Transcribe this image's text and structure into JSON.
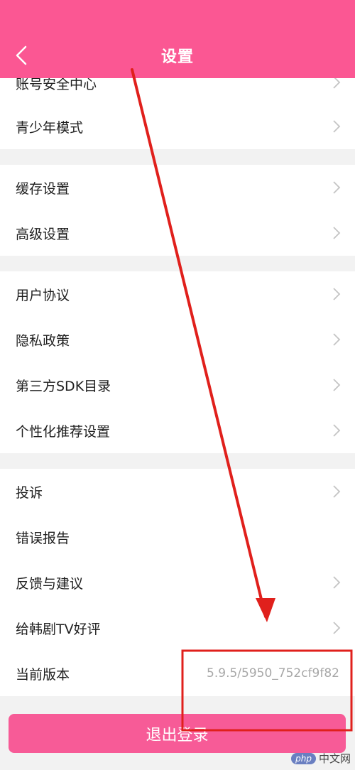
{
  "header": {
    "title": "设置",
    "back_icon": "chevron-left-icon"
  },
  "rows": [
    {
      "label": "账号安全中心",
      "chevron": true
    },
    {
      "label": "青少年模式",
      "chevron": true
    },
    {
      "label": "缓存设置",
      "chevron": true
    },
    {
      "label": "高级设置",
      "chevron": true
    },
    {
      "label": "用户协议",
      "chevron": true
    },
    {
      "label": "隐私政策",
      "chevron": true
    },
    {
      "label": "第三方SDK目录",
      "chevron": true
    },
    {
      "label": "个性化推荐设置",
      "chevron": true
    },
    {
      "label": "投诉",
      "chevron": true
    },
    {
      "label": "错误报告",
      "chevron": false
    },
    {
      "label": "反馈与建议",
      "chevron": true
    },
    {
      "label": "给韩剧TV好评",
      "chevron": true
    },
    {
      "label": "当前版本",
      "value": "5.9.5/5950_752cf9f82"
    }
  ],
  "logout_label": "退出登录",
  "watermark": {
    "badge": "php",
    "text": "中文网"
  },
  "colors": {
    "header": "#fb5793",
    "logout": "#f75b97",
    "annotation": "#e0201c",
    "background": "#f2f2f2"
  }
}
